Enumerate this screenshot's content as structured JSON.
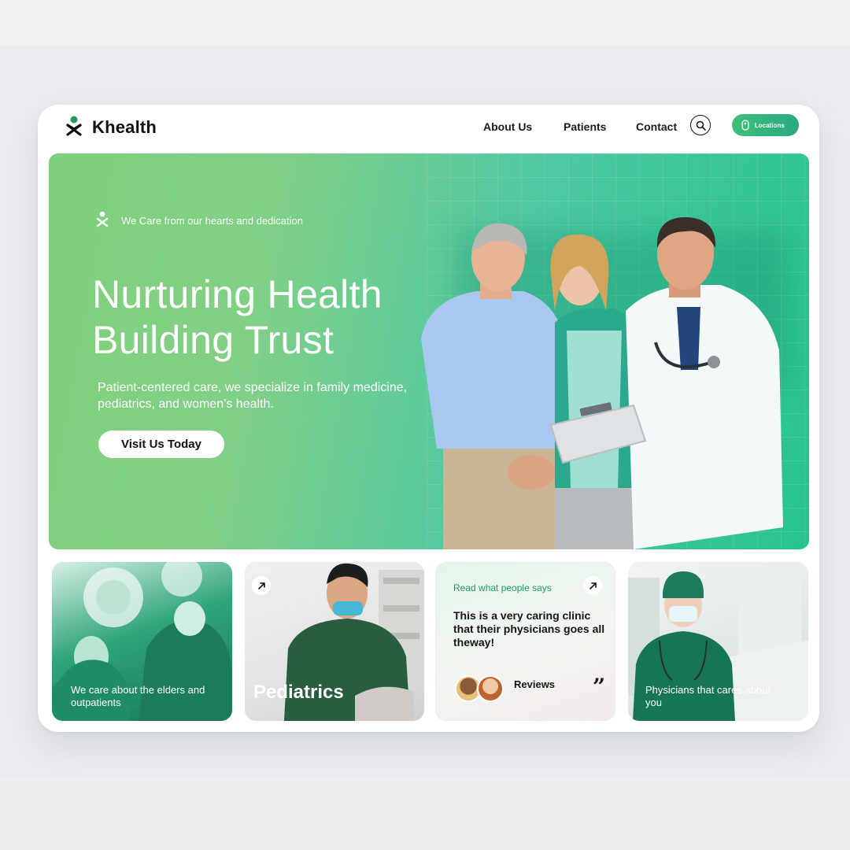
{
  "header": {
    "brand": "Khealth",
    "nav": [
      "About Us",
      "Patients",
      "Contact"
    ],
    "locations_label": "Locations"
  },
  "hero": {
    "tagline": "We Care from our hearts and dedication",
    "title_line1": "Nurturing Health",
    "title_line2": "Building Trust",
    "description": "Patient-centered care, we specialize in family medicine, pediatrics, and women’s health.",
    "cta": "Visit Us Today"
  },
  "cards": {
    "elders": "We care about the elders and outpatients",
    "pediatrics": "Pediatrics",
    "reviews": {
      "heading": "Read what people says",
      "quote": "This is a very caring clinic that their physicians goes all theway!",
      "label": "Reviews",
      "quote_mark": "”"
    },
    "physicians": "Physicians that cares about you"
  },
  "colors": {
    "brand_green": "#1e9b5a",
    "hero_start": "#7fd07a",
    "hero_end": "#27c38c",
    "locations_button": "#3fbf7a"
  },
  "icons": [
    "khealth-logo-icon",
    "search-icon",
    "location-pin-icon",
    "arrow-up-right-icon"
  ]
}
